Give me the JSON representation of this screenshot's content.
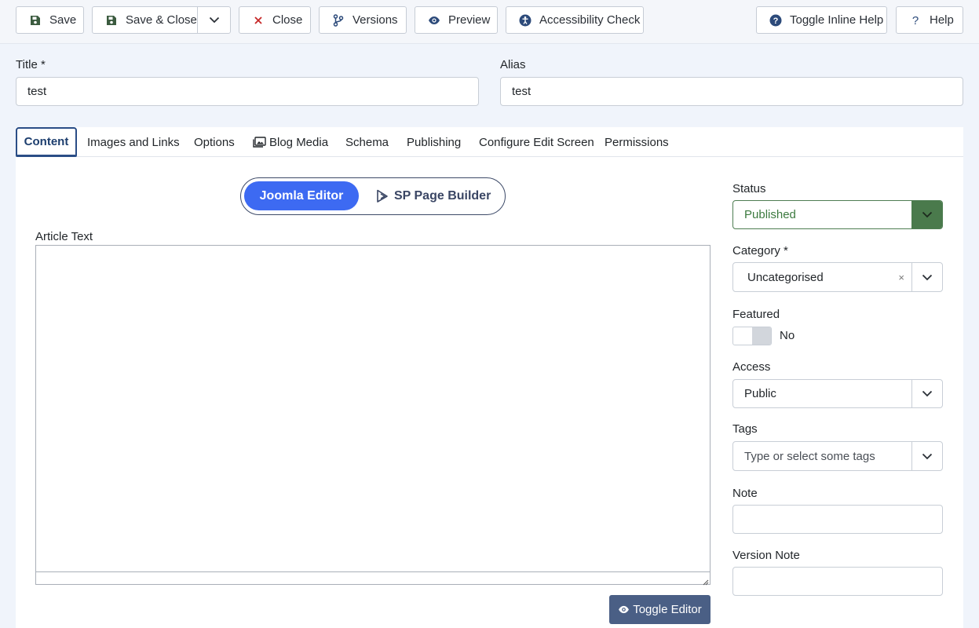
{
  "toolbar": {
    "save": "Save",
    "save_close": "Save & Close",
    "close": "Close",
    "versions": "Versions",
    "preview": "Preview",
    "accessibility": "Accessibility Check",
    "toggle_inline_help": "Toggle Inline Help",
    "help": "Help"
  },
  "fields": {
    "title_label": "Title *",
    "title_value": "test",
    "alias_label": "Alias",
    "alias_value": "test"
  },
  "tabs": [
    {
      "label": "Content",
      "active": true
    },
    {
      "label": "Images and Links"
    },
    {
      "label": "Options"
    },
    {
      "label": "Blog Media"
    },
    {
      "label": "Schema"
    },
    {
      "label": "Publishing"
    },
    {
      "label": "Configure Edit Screen"
    },
    {
      "label": "Permissions"
    }
  ],
  "editor_switch": {
    "joomla": "Joomla Editor",
    "sppb": "SP Page Builder"
  },
  "article": {
    "label": "Article Text",
    "toggle_editor": "Toggle Editor"
  },
  "sidebar": {
    "status_label": "Status",
    "status_value": "Published",
    "category_label": "Category *",
    "category_value": "Uncategorised",
    "category_clear": "×",
    "featured_label": "Featured",
    "featured_value": "No",
    "access_label": "Access",
    "access_value": "Public",
    "tags_label": "Tags",
    "tags_placeholder": "Type or select some tags",
    "note_label": "Note",
    "version_note_label": "Version Note"
  },
  "colors": {
    "primary": "#3d6af2",
    "status_green": "#4a7a4c",
    "toggle_editor_bg": "#4a5f85",
    "tab_active": "#2a4d86"
  }
}
